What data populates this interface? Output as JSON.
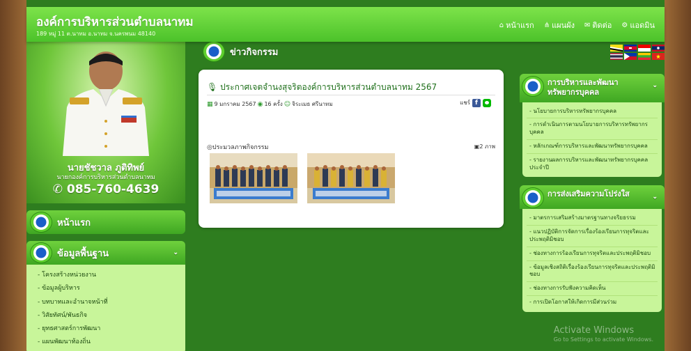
{
  "header": {
    "title": "องค์การบริหารส่วนตำบลนาทม",
    "address": "189 หมู่ 11 ต.นาทม อ.นาทม จ.นครพนม 48140",
    "nav": [
      {
        "icon": "home-icon",
        "glyph": "⌂",
        "label": "หน้าแรก"
      },
      {
        "icon": "sitemap-icon",
        "glyph": "⋔",
        "label": "แผนผัง"
      },
      {
        "icon": "mail-icon",
        "glyph": "✉",
        "label": "ติดต่อ"
      },
      {
        "icon": "cogs-icon",
        "glyph": "⚙",
        "label": "แอดมิน"
      }
    ]
  },
  "profile": {
    "name": "นายชัชวาล ภูติทิพย์",
    "position": "นายกองค์การบริหารส่วนตำบลนาทม",
    "phone": "085-760-4639"
  },
  "left_menu": {
    "home": "หน้าแรก",
    "basic_info": "ข้อมูลพื้นฐาน",
    "basic_items": [
      "โครงสร้างหน่วยงาน",
      "ข้อมูลผู้บริหาร",
      "บทบาทและอำนาจหน้าที่",
      "วิสัยทัศน์/พันธกิจ",
      "ยุทธศาสตร์การพัฒนา",
      "แผนพัฒนาท้องถิ่น"
    ]
  },
  "news": {
    "section_title": "ข่าวกิจกรรม",
    "title": "ประกาศเจตจำนงสุจริตองค์การบริหารส่วนตำบลนาทม 2567",
    "date": "9 มกราคม 2567",
    "views": "16 ครั้ง",
    "author": "จิระเมธ ศรีนาทม",
    "share_label": "แชร์",
    "gallery_label": "ประมวลภาพกิจกรรม",
    "photo_count": "2 ภาพ"
  },
  "right_menu": {
    "hr_title": "การบริหารและพัฒนาทรัพยากรบุคคล",
    "hr_items": [
      "นโยบายการบริหารทรัพยากรบุคคล",
      "การดำเนินการตามนโยบายการบริหารทรัพยากรบุคคล",
      "หลักเกณฑ์การบริหารและพัฒนาทรัพยากรบุคคล",
      "รายงานผลการบริหารและพัฒนาทรัพยากรบุคคลประจำปี"
    ],
    "transparency_title": "การส่งเสริมความโปร่งใส",
    "transparency_items": [
      "มาตรการเสริมสร้างมาตรฐานทางจริยธรรม",
      "แนวปฏิบัติการจัดการเรื่องร้องเรียนการทุจริตและประพฤติมิชอบ",
      "ช่องทางการร้องเรียนการทุจริตและประพฤติมิชอบ",
      "ข้อมูลเชิงสถิติเรื่องร้องเรียนการทุจริตและประพฤติมิชอบ",
      "ช่องทางการรับฟังความคิดเห็น",
      "การเปิดโอกาสให้เกิดการมีส่วนร่วม"
    ]
  },
  "watermark": {
    "line1": "Activate Windows",
    "line2": "Go to Settings to activate Windows."
  },
  "colors": {
    "header": "#4cc22a",
    "background": "#2e7d1f",
    "submenu": "#c8f59a",
    "link_text": "#1e6f1a"
  }
}
